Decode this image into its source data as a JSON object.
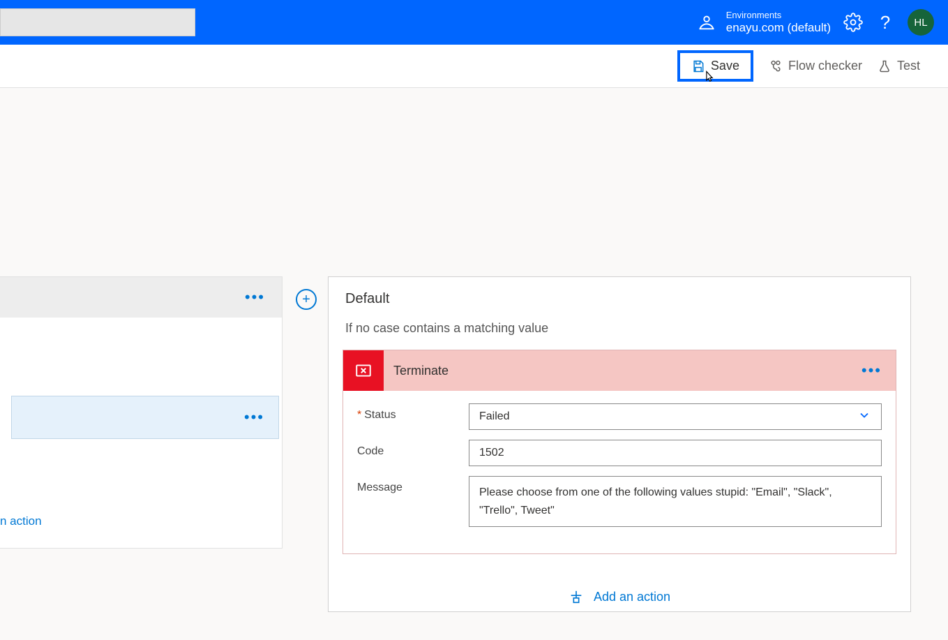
{
  "header": {
    "environments_label": "Environments",
    "environment_name": "enayu.com (default)",
    "avatar_initials": "HL"
  },
  "commands": {
    "save": "Save",
    "flow_checker": "Flow checker",
    "test": "Test"
  },
  "left_case": {
    "add_action": "n action"
  },
  "default_case": {
    "title": "Default",
    "subtitle": "If no case contains a matching value",
    "terminate": {
      "title": "Terminate",
      "fields": {
        "status_label": "Status",
        "status_value": "Failed",
        "code_label": "Code",
        "code_value": "1502",
        "message_label": "Message",
        "message_value": "Please choose from one of the following values stupid: \"Email\", \"Slack\", \"Trello\", Tweet\""
      }
    },
    "add_action": "Add an action"
  }
}
